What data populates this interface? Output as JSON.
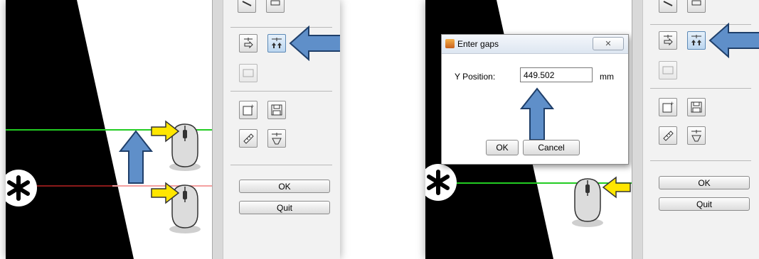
{
  "left": {
    "ok_label": "OK",
    "quit_label": "Quit"
  },
  "right": {
    "ok_label": "OK",
    "quit_label": "Quit"
  },
  "dialog": {
    "title": "Enter gaps",
    "close_glyph": "✕",
    "y_label": "Y Position:",
    "y_value": "449.502",
    "unit": "mm",
    "ok_label": "OK",
    "cancel_label": "Cancel"
  },
  "colors": {
    "arrow_blue": "#5f8fc9",
    "arrow_outline": "#1f3f6a",
    "callout_yellow": "#ffe600",
    "green_line": "#22cc22",
    "red_line": "#8b1a1a"
  },
  "icons": [
    "marker-arrow-icon",
    "gap-arrows-icon",
    "rectangle-icon",
    "new-file-icon",
    "save-disk-icon",
    "ruler-icon",
    "marker-cup-icon",
    "mouse-icon",
    "asterisk-marker-icon"
  ]
}
